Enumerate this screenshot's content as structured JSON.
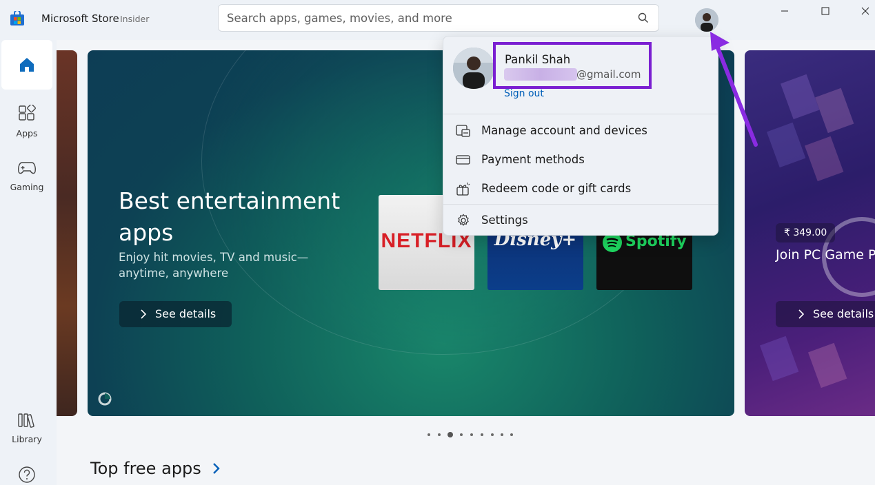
{
  "titlebar": {
    "app_name": "Microsoft Store",
    "badge": "Insider",
    "search_placeholder": "Search apps, games, movies, and more"
  },
  "sidebar": {
    "items": [
      {
        "label": "Home",
        "icon": "home-icon"
      },
      {
        "label": "Apps",
        "icon": "apps-icon"
      },
      {
        "label": "Gaming",
        "icon": "gamepad-icon"
      },
      {
        "label": "Library",
        "icon": "library-icon"
      },
      {
        "label": "Help",
        "icon": "help-icon"
      }
    ]
  },
  "hero": {
    "title": "Best entertainment apps",
    "subtitle": "Enjoy hit movies, TV and music—anytime, anywhere",
    "button": "See details",
    "tiles": [
      "NETFLIX",
      "Disney+",
      "Spotify"
    ]
  },
  "right_card": {
    "price": "₹ 349.00",
    "title": "Join PC Game P",
    "button": "See details"
  },
  "carousel": {
    "count": 9,
    "active_index": 2
  },
  "section": {
    "title": "Top free apps"
  },
  "account_flyout": {
    "name": "Pankil Shah",
    "email_domain": "@gmail.com",
    "sign_out": "Sign out",
    "menu": [
      {
        "label": "Manage account and devices",
        "icon": "devices-icon"
      },
      {
        "label": "Payment methods",
        "icon": "credit-card-icon"
      },
      {
        "label": "Redeem code or gift cards",
        "icon": "gift-icon"
      },
      {
        "label": "Settings",
        "icon": "gear-icon"
      }
    ]
  },
  "colors": {
    "accent": "#005fb8",
    "highlight": "#7a1fd1",
    "hero_bg": "#0f5f5a"
  }
}
